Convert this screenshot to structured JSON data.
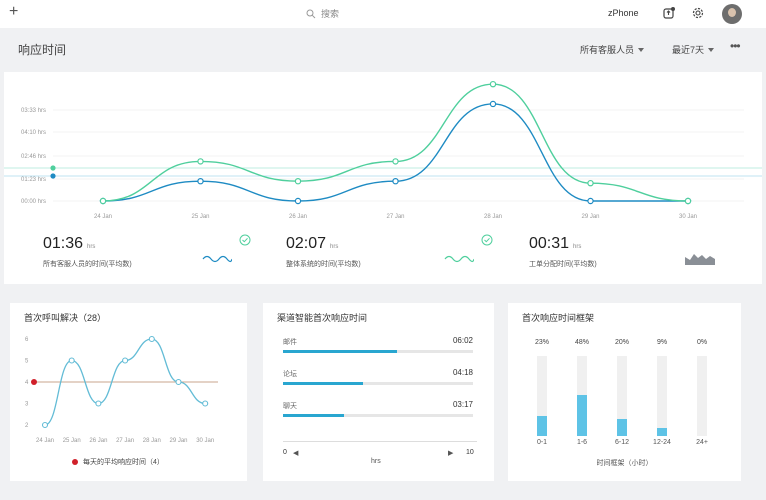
{
  "topbar": {
    "add_label": "+",
    "search_placeholder": "搜索",
    "org_name": "zPhone"
  },
  "header": {
    "title": "响应时间",
    "agent_filter": "所有客服人员",
    "period_filter": "最近7天",
    "more": "•••"
  },
  "response_chart": {
    "y_ticks": [
      "03:33 hrs",
      "04:10 hrs",
      "02:46 hrs",
      "01:23 hrs",
      "00:00 hrs"
    ],
    "x_labels": [
      "24 Jan",
      "25 Jan",
      "26 Jan",
      "27 Jan",
      "28 Jan",
      "29 Jan",
      "30 Jan"
    ],
    "colors": {
      "agent_line": "#1e8bc3",
      "system_line": "#4fcf9d"
    }
  },
  "chart_data": [
    {
      "type": "line",
      "title": "",
      "categories": [
        "24 Jan",
        "25 Jan",
        "26 Jan",
        "27 Jan",
        "28 Jan",
        "29 Jan",
        "30 Jan"
      ],
      "ylim": [
        0,
        5
      ],
      "series": [
        {
          "values": [
            0,
            1.0,
            0,
            1.0,
            4.9,
            0,
            0
          ]
        },
        {
          "values": [
            0,
            2.0,
            1.0,
            2.0,
            5.9,
            0.9,
            0
          ]
        }
      ]
    },
    {
      "type": "line",
      "title": "首次呼叫解决（28）",
      "categories": [
        "24 Jan",
        "25 Jan",
        "26 Jan",
        "27 Jan",
        "28 Jan",
        "29 Jan",
        "30 Jan"
      ],
      "y_ticks": [
        "6",
        "5",
        "4",
        "3",
        "2"
      ],
      "ylim": [
        1.5,
        6.5
      ],
      "series": [
        {
          "values": [
            2,
            5,
            3,
            5,
            6,
            4,
            3
          ]
        }
      ],
      "average": {
        "value": 4,
        "label": "每天的平均响应时间（4）"
      }
    },
    {
      "type": "bar",
      "title": "首次响应时间框架",
      "categories": [
        "0-1",
        "1-6",
        "6-12",
        "12-24",
        "24+"
      ],
      "values": [
        23,
        48,
        20,
        9,
        0
      ],
      "xlabel": "时间框架（小时）"
    }
  ],
  "stats": [
    {
      "value": "01:36",
      "unit": "hrs",
      "label": "所有客服人员的时间(平均数)"
    },
    {
      "value": "02:07",
      "unit": "hrs",
      "label": "整体系统的时间(平均数)"
    },
    {
      "value": "00:31",
      "unit": "hrs",
      "label": "工单分配时间(平均数)"
    }
  ],
  "fcr_panel": {
    "title": "首次呼叫解决（28）",
    "legend": "每天的平均响应时间（4）"
  },
  "channel_panel": {
    "title": "渠道智能首次响应时间",
    "channels": [
      {
        "name": "邮件",
        "value": "06:02",
        "fraction": 0.6
      },
      {
        "name": "论坛",
        "value": "04:18",
        "fraction": 0.42
      },
      {
        "name": "聊天",
        "value": "03:17",
        "fraction": 0.32
      }
    ],
    "axis_min": "0",
    "axis_max": "10",
    "axis_unit": "hrs"
  },
  "frame_panel": {
    "title": "首次响应时间框架",
    "bars": [
      {
        "pct": "23%",
        "label": "0-1",
        "fraction": 0.23
      },
      {
        "pct": "48%",
        "label": "1-6",
        "fraction": 0.48
      },
      {
        "pct": "20%",
        "label": "6-12",
        "fraction": 0.2
      },
      {
        "pct": "9%",
        "label": "12-24",
        "fraction": 0.09
      },
      {
        "pct": "0%",
        "label": "24+",
        "fraction": 0
      }
    ],
    "xlabel": "时间框架（小时）"
  }
}
